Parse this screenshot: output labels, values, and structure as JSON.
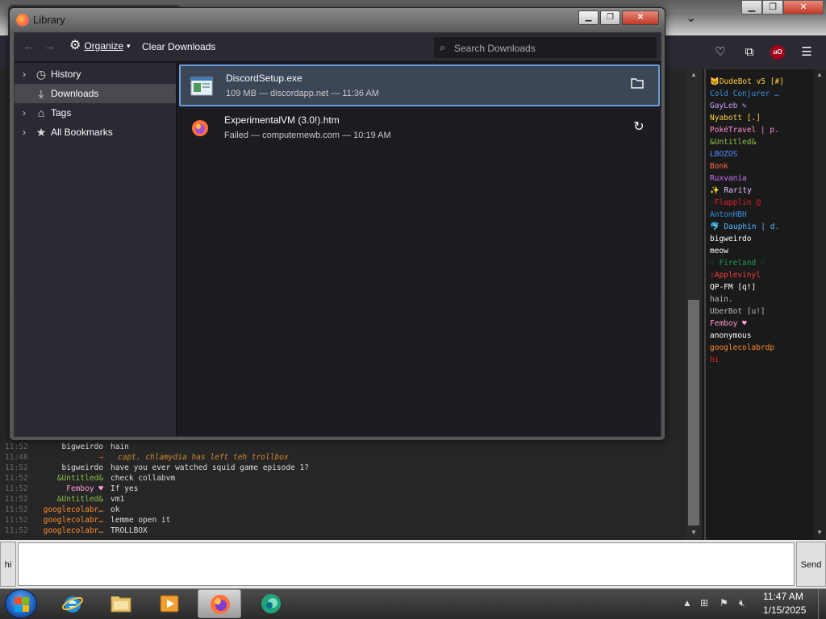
{
  "library": {
    "title": "Library",
    "toolbar": {
      "organize_label": "Organize",
      "clear_downloads_label": "Clear Downloads",
      "search_placeholder": "Search Downloads"
    },
    "sidebar": {
      "items": [
        {
          "label": "History",
          "icon": "clock-icon"
        },
        {
          "label": "Downloads",
          "icon": "download-icon"
        },
        {
          "label": "Tags",
          "icon": "tag-icon"
        },
        {
          "label": "All Bookmarks",
          "icon": "star-icon"
        }
      ]
    },
    "downloads": [
      {
        "name": "DiscordSetup.exe",
        "status": "109 MB — discordapp.net — 11:36 AM",
        "action_icon": "folder-icon"
      },
      {
        "name": "ExperimentalVM (3.0!).htm",
        "status": "Failed — computernewb.com — 10:19 AM",
        "action_icon": "retry-icon"
      }
    ]
  },
  "chat": {
    "lines": [
      {
        "time": "11:52",
        "user": "bigweirdo",
        "user_color": "#dddddd",
        "message": "hain",
        "italic": false
      },
      {
        "time": "11:48",
        "user": "→",
        "user_color": "#e05050",
        "message": "capt. chlamydia has left teh trollbox",
        "italic": true
      },
      {
        "time": "11:52",
        "user": "bigweirdo",
        "user_color": "#dddddd",
        "message": "have you ever watched squid game episode 1?",
        "italic": false
      },
      {
        "time": "11:52",
        "user": "&Untitled&",
        "user_color": "#8bc34a",
        "message": "check collabvm",
        "italic": false
      },
      {
        "time": "11:52",
        "user": "Femboy ♥",
        "user_color": "#ff9ad5",
        "message": "If yes",
        "italic": false
      },
      {
        "time": "11:52",
        "user": "&Untitled&",
        "user_color": "#8bc34a",
        "message": "vm1",
        "italic": false
      },
      {
        "time": "11:52",
        "user": "googlecolabr…",
        "user_color": "#ff8c2a",
        "message": "ok",
        "italic": false
      },
      {
        "time": "11:52",
        "user": "googlecolabr…",
        "user_color": "#ff8c2a",
        "message": "lemme open it",
        "italic": false
      },
      {
        "time": "11:52",
        "user": "googlecolabr…",
        "user_color": "#ff8c2a",
        "message": "TROLLBOX",
        "italic": false
      }
    ],
    "users": [
      {
        "name": "🐱DudeBot v5 [#]",
        "color": "#ffd23f"
      },
      {
        "name": "Cold Conjurer …",
        "color": "#3a8dde"
      },
      {
        "name": "GayLeb ✎",
        "color": "#c8a2ff"
      },
      {
        "name": "Nyabott [.]",
        "color": "#ffd23f"
      },
      {
        "name": "PokéTravel | p.",
        "color": "#ff8ad8"
      },
      {
        "name": "&Untitled&",
        "color": "#8bc34a"
      },
      {
        "name": "LBOZOS",
        "color": "#5b8dff"
      },
      {
        "name": "Bonk",
        "color": "#ff6f3c"
      },
      {
        "name": "Ruxvania",
        "color": "#d070ff"
      },
      {
        "name": "✨ Rarity",
        "color": "#e6c3ff"
      },
      {
        "name": "-Flapplin @",
        "color": "#e0202a"
      },
      {
        "name": "AntonHBH",
        "color": "#3a8dde"
      },
      {
        "name": "🐬 Dauphin | d.",
        "color": "#4fb7ff"
      },
      {
        "name": "bigweirdo",
        "color": "#ffffff"
      },
      {
        "name": "meow",
        "color": "#ffffff"
      },
      {
        "name": "♢ Fireland ♢",
        "color": "#1d9c5a"
      },
      {
        "name": ":Applevinyl",
        "color": "#ff3b3b"
      },
      {
        "name": "QP-FM [q!]",
        "color": "#ffffff"
      },
      {
        "name": "hain.",
        "color": "#bbbbbb"
      },
      {
        "name": "UberBot [u!]",
        "color": "#bbbbbb"
      },
      {
        "name": "Femboy ♥",
        "color": "#ff9ad5"
      },
      {
        "name": "anonymous",
        "color": "#ffffff"
      },
      {
        "name": "googlecolabrdp",
        "color": "#ff8c2a"
      },
      {
        "name": "hi",
        "color": "#e0202a"
      }
    ],
    "hi_label": "hi",
    "send_label": "Send"
  },
  "taskbar": {
    "time": "11:47 AM",
    "date": "1/15/2025"
  },
  "colors": {
    "accent": "#6e9bd8",
    "library_bg": "#1c1b22",
    "sidebar_bg": "#2b2a33"
  }
}
